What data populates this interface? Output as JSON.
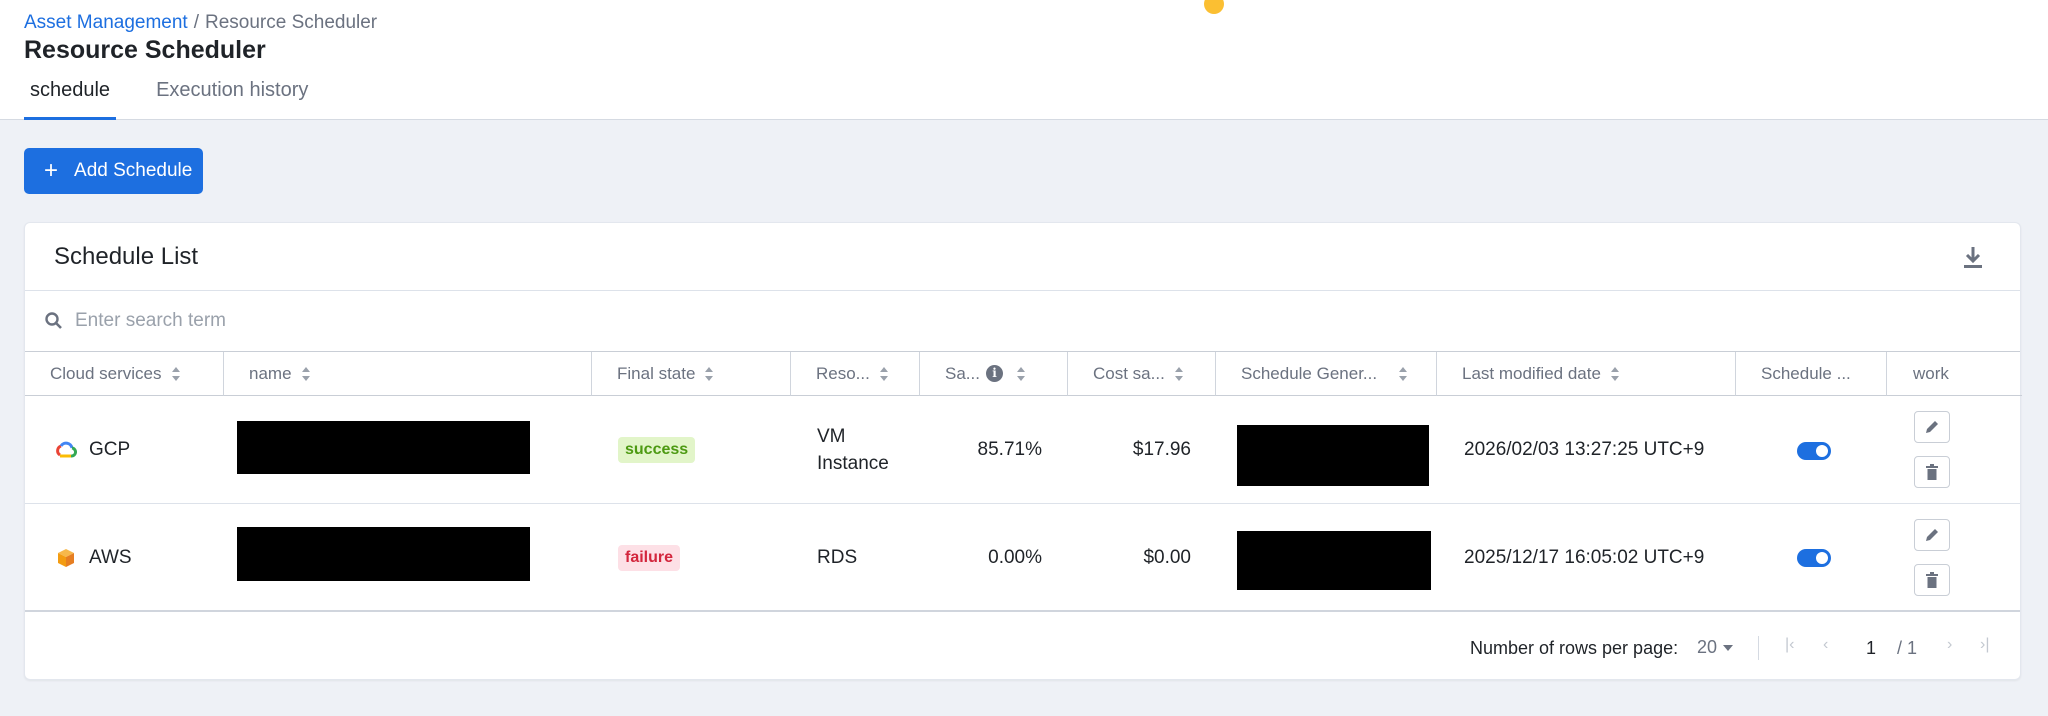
{
  "breadcrumb": {
    "parent": "Asset Management",
    "separator": "/",
    "current": "Resource Scheduler"
  },
  "page_title": "Resource Scheduler",
  "tabs": [
    {
      "label": "schedule",
      "active": true
    },
    {
      "label": "Execution history",
      "active": false
    }
  ],
  "add_button": {
    "label": "Add Schedule",
    "icon": "plus-icon"
  },
  "card": {
    "title": "Schedule List",
    "download_icon": "download-icon",
    "search": {
      "placeholder": "Enter search term",
      "value": ""
    }
  },
  "columns": [
    {
      "label": "Cloud services",
      "sortable": true
    },
    {
      "label": "name",
      "sortable": true
    },
    {
      "label": "Final state",
      "sortable": true
    },
    {
      "label": "Reso...",
      "sortable": true
    },
    {
      "label": "Sa...",
      "sortable": true,
      "info": true
    },
    {
      "label": "Cost sa...",
      "sortable": true
    },
    {
      "label": "Schedule Gener...",
      "sortable": true
    },
    {
      "label": "Last modified date",
      "sortable": true
    },
    {
      "label": "Schedule ...",
      "sortable": false
    },
    {
      "label": "work",
      "sortable": false
    }
  ],
  "rows": [
    {
      "cloud": "GCP",
      "cloud_icon": "gcp-cloud-icon",
      "name": "",
      "final_state": "success",
      "resource_line1": "VM",
      "resource_line2": "Instance",
      "savings_rate": "85.71%",
      "cost_savings": "$17.96",
      "schedule_generator": "",
      "last_modified": "2026/02/03 13:27:25 UTC+9",
      "schedule_enabled": true
    },
    {
      "cloud": "AWS",
      "cloud_icon": "aws-cube-icon",
      "name": "",
      "final_state": "failure",
      "resource_line1": "RDS",
      "resource_line2": "",
      "savings_rate": "0.00%",
      "cost_savings": "$0.00",
      "schedule_generator": "",
      "last_modified": "2025/12/17 16:05:02 UTC+9",
      "schedule_enabled": true
    }
  ],
  "pagination": {
    "rows_per_page_label": "Number of rows per page:",
    "rows_per_page": "20",
    "current_page": "1",
    "total_pages": "/ 1"
  },
  "colors": {
    "accent": "#1d6fe0",
    "success_bg": "#e2f5c9",
    "failure_bg": "#fde0e6"
  }
}
